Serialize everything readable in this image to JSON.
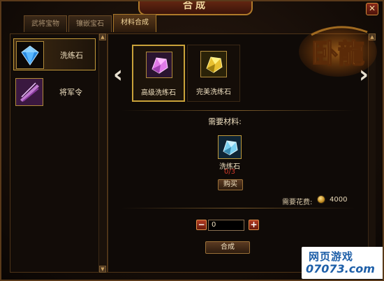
{
  "window": {
    "title": "合成",
    "close_label": "✕"
  },
  "tabs": [
    {
      "label": "武将宝物",
      "active": false
    },
    {
      "label": "镶嵌宝石",
      "active": false
    },
    {
      "label": "材料合成",
      "active": true
    }
  ],
  "recipe_list": [
    {
      "label": "洗练石",
      "icon": "blue-gem-icon",
      "selected": true
    },
    {
      "label": "将军令",
      "icon": "purple-blade-icon",
      "selected": false
    }
  ],
  "products": [
    {
      "label": "高级洗练石",
      "icon": "pink-crystal-icon",
      "selected": true
    },
    {
      "label": "完美洗练石",
      "icon": "gold-crystal-icon",
      "selected": false
    }
  ],
  "materials": {
    "title": "需要材料:",
    "name": "洗练石",
    "count": "0/3",
    "buy_label": "购买"
  },
  "cost": {
    "label": "需要花费:",
    "value": "4000"
  },
  "quantity": {
    "value": "0",
    "minus": "−",
    "plus": "+"
  },
  "synthesize_label": "合成",
  "logo": {
    "text": "卧龍"
  },
  "watermark": {
    "line1": "网页游戏",
    "line2": "07073.com"
  },
  "colors": {
    "accent": "#c9a23a",
    "count_red": "#d23a2a",
    "watermark_blue": "#1e5fa8"
  }
}
